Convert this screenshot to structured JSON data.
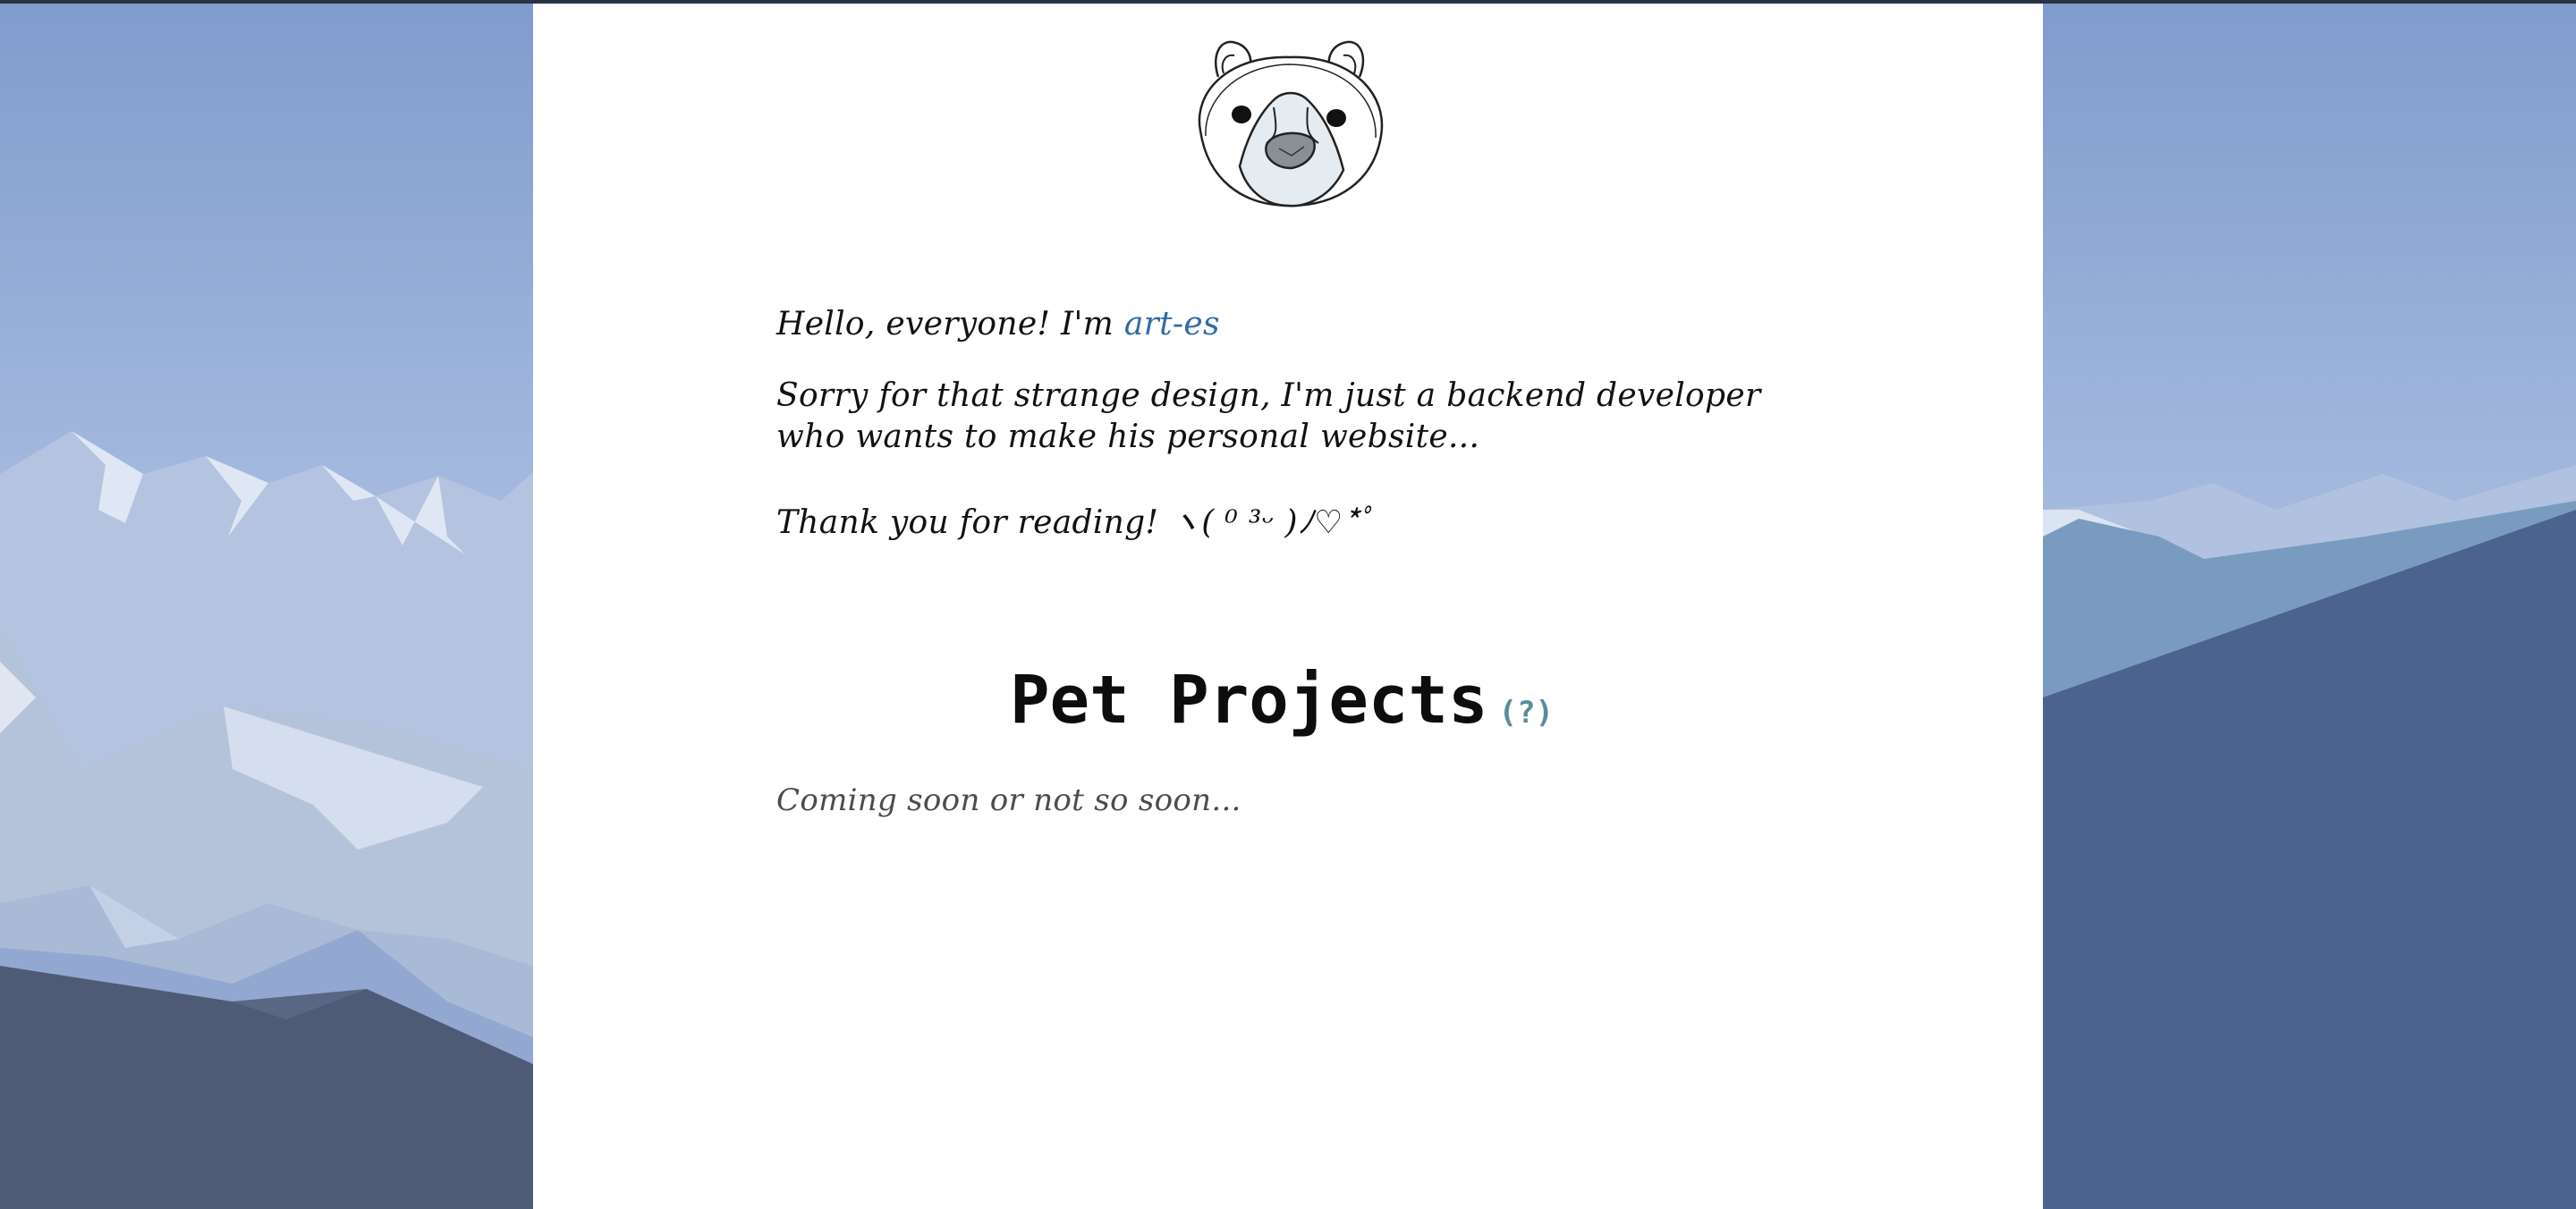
{
  "colors": {
    "link": "#2f6aa8",
    "help_link": "#5b8c9c",
    "sky_top": "#7f9ccd",
    "sky_bottom": "#b9c7e2",
    "mountain_dark": "#4f5b76",
    "mountain_right": "#4b638e",
    "content_bg": "#ffffff"
  },
  "icons": {
    "logo": "polar-bear-head-icon"
  },
  "intro": {
    "hello_prefix": "Hello, everyone! I'm ",
    "name_link": "art-es",
    "sorry": "Sorry for that strange design, I'm just a backend developer who wants to make his personal website...",
    "thanks": "Thank you for reading! ヽ( ⁰ ³ᵕ )ﾉ♡*ﾟ"
  },
  "projects": {
    "title": "Pet Projects",
    "help": "(?)",
    "placeholder": "Coming soon or not so soon..."
  }
}
